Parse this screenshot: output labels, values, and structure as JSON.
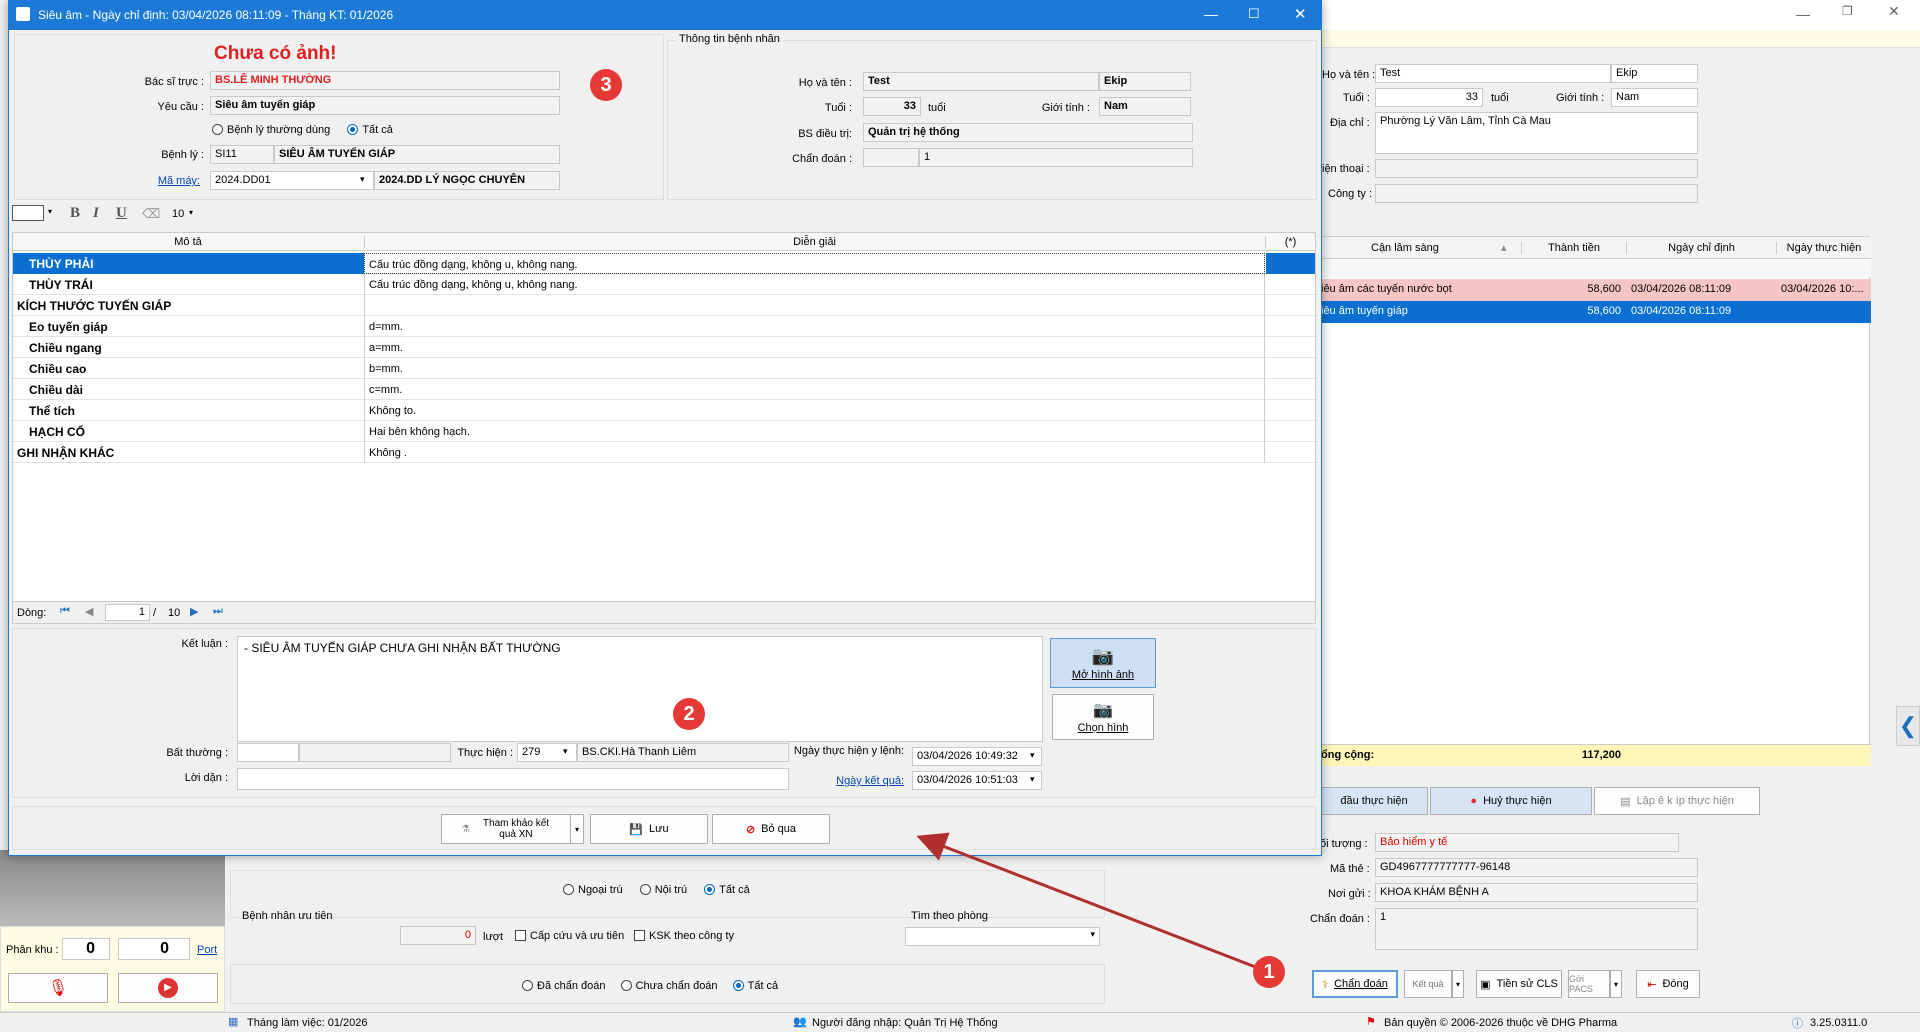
{
  "dialog": {
    "title": "Siêu âm - Ngày chỉ định: 03/04/2026 08:11:09 - Tháng KT: 01/2026",
    "no_image": "Chưa có ảnh!",
    "doctor_label": "Bác sĩ trực :",
    "doctor_value": "BS.LÊ MINH THƯỜNG",
    "request_label": "Yêu cầu :",
    "request_value": "Siêu âm tuyến giáp",
    "radio_common": "Bệnh lý thường dùng",
    "radio_all": "Tất cả",
    "disease_label": "Bệnh lý :",
    "disease_code": "SI11",
    "disease_name": "SIÊU ÂM TUYẾN GIÁP",
    "machine_label": "Mã máy:",
    "machine_code": "2024.DD01",
    "machine_name": "2024.DD LÝ NGỌC CHUYÊN",
    "patient_section": "Thông tin bệnh nhân",
    "name_label": "Họ và tên :",
    "name_value": "Test",
    "ekip": "Ekip",
    "age_label": "Tuổi :",
    "age_value": "33",
    "age_unit": "tuổi",
    "gender_label": "Giới tính :",
    "gender_value": "Nam",
    "bs_label": "BS điều trị:",
    "bs_value": "Quản trị hệ thống",
    "diag_label": "Chẩn đoán :",
    "diag_value": "1",
    "font_size": "10",
    "col_desc": "Mô tả",
    "col_expl": "Diễn giải",
    "col_star": "(*)",
    "rows": [
      {
        "desc": "THÙY PHẢI",
        "expl": "Cấu trúc đồng dạng, không u, không nang.",
        "indent": true
      },
      {
        "desc": "THÙY TRÁI",
        "expl": "Cấu trúc đồng dạng, không u, không nang.",
        "indent": true
      },
      {
        "desc": "KÍCH THƯỚC TUYẾN GIÁP",
        "expl": "",
        "indent": false
      },
      {
        "desc": "Eo tuyến giáp",
        "expl": "d=mm.",
        "indent": true
      },
      {
        "desc": "Chiều ngang",
        "expl": "a=mm.",
        "indent": true
      },
      {
        "desc": "Chiều cao",
        "expl": "b=mm.",
        "indent": true
      },
      {
        "desc": "Chiều dài",
        "expl": "c=mm.",
        "indent": true
      },
      {
        "desc": "Thể tích",
        "expl": "Không to.",
        "indent": true
      },
      {
        "desc": "HẠCH CỔ",
        "expl": "Hai bên không hạch.",
        "indent": true
      },
      {
        "desc": "GHI NHẬN KHÁC",
        "expl": "Không .",
        "indent": false
      }
    ],
    "nav_label": "Dòng:",
    "nav_current": "1",
    "nav_sep": "/",
    "nav_total": "10",
    "conclusion_label": "Kết luận :",
    "conclusion_value": "- SIÊU ÂM TUYẾN GIÁP CHƯA GHI  NHẬN BẤT THƯỜNG",
    "open_image": "Mở hình ảnh",
    "choose_image": "Chọn hình",
    "abnormal_label": "Bất thường :",
    "perform_label": "Thực hiện :",
    "perform_code": "279",
    "perform_name": "BS.CKI.Hà Thanh Liêm",
    "date_perform_label": "Ngày thực hiện y lệnh:",
    "date_perform_value": "03/04/2026 10:49:32",
    "advice_label": "Lời dặn :",
    "date_result_label": "Ngày kết quả:",
    "date_result_value": "03/04/2026 10:51:03",
    "btn_ref": "Tham khảo kết quả XN",
    "btn_save": "Lưu",
    "btn_skip": "Bỏ qua"
  },
  "right_panel": {
    "name_label": "Họ và tên :",
    "name_value": "Test",
    "ekip": "Ekip",
    "age_label": "Tuổi :",
    "age_value": "33",
    "age_unit": "tuổi",
    "gender_label": "Giới tính :",
    "gender_value": "Nam",
    "address_label": "Địa chỉ :",
    "address_value": "Phường Lý Văn Lâm, Tỉnh Cà Mau",
    "phone_label": "iện thoại :",
    "company_label": "Công ty :",
    "table_headers": [
      "Cận lâm sàng",
      "Thành tiền",
      "Ngày chỉ định",
      "Ngày thực hiện"
    ],
    "table_rows": [
      {
        "name": "iêu âm các tuyến nước bọt",
        "price": "58,600",
        "date": "03/04/2026 08:11:09",
        "done": "03/04/2026 10:..."
      },
      {
        "name": "iêu âm tuyến giáp",
        "price": "58,600",
        "date": "03/04/2026 08:11:09",
        "done": ""
      }
    ],
    "total_label": "ổng cộng:",
    "total_value": "117,200",
    "btn_start": "đầu thực hiện",
    "btn_cancel": "Huỷ thực hiện",
    "btn_ekip": "Lập ê k íp thực hiện",
    "object_label": "ối tượng :",
    "object_value": "Bảo hiểm y tế",
    "card_label": "Mã thẻ :",
    "card_value": "GD4967777777777-96148",
    "sender_label": "Nơi gửi :",
    "sender_value": "KHOA KHÁM BỆNH A",
    "diag_label": "Chẩn đoán :",
    "diag_value": "1",
    "btn_diag": "Chẩn đoán",
    "btn_result": "Kết quả",
    "btn_history": "Tiền sử CLS",
    "btn_pacs": "Gửi PACS",
    "btn_close": "Đóng"
  },
  "bottom": {
    "radio_out": "Ngoại trú",
    "radio_in": "Nội trú",
    "radio_all": "Tất cả",
    "priority_label": "Bệnh nhân ưu tiên",
    "priority_count": "0",
    "priority_unit": "lượt",
    "emergency": "Cấp cứu và ưu tiên",
    "ksk": "KSK theo công ty",
    "room_label": "Tìm theo phòng",
    "zone_label": "Phân khu :",
    "zone_value": "0",
    "zone_value2": "0",
    "port": "Port",
    "radio_diag": "Đã chẩn đoán",
    "radio_nodiag": "Chưa chẩn đoán",
    "radio_all2": "Tất cả"
  },
  "status": {
    "month": "Tháng làm việc: 01/2026",
    "user": "Người đăng nhập: Quản Trị Hệ Thống",
    "copyright": "Bản quyền © 2006-2026 thuộc về DHG Pharma",
    "version": "3.25.0311.0"
  },
  "badges": {
    "b1": "1",
    "b2": "2",
    "b3": "3"
  }
}
